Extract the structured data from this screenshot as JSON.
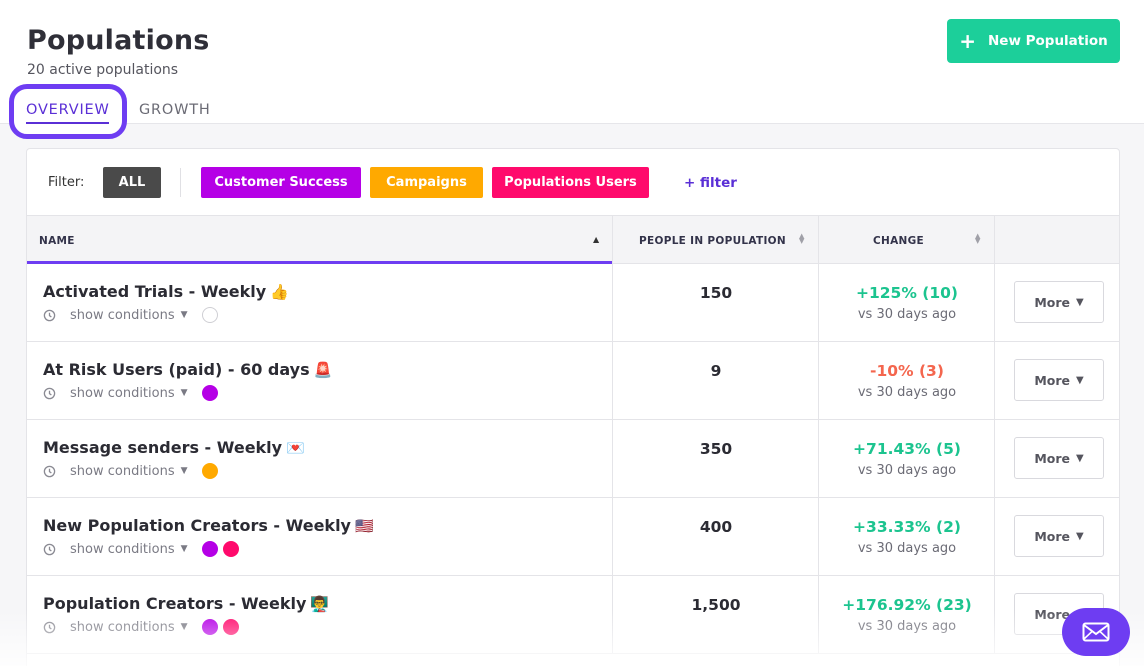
{
  "header": {
    "title": "Populations",
    "subtitle": "20 active populations",
    "new_button_label": "New Population",
    "new_button_icon": "plus-icon"
  },
  "tabs": [
    {
      "label": "OVERVIEW",
      "active": true
    },
    {
      "label": "GROWTH",
      "active": false
    }
  ],
  "filters": {
    "label": "Filter:",
    "chips": [
      {
        "label": "ALL",
        "color": "#4a4a4a"
      },
      {
        "label": "Customer Success",
        "color": "#b500e6"
      },
      {
        "label": "Campaigns",
        "color": "#ffa900"
      },
      {
        "label": "Populations Users",
        "color": "#ff0a6c"
      }
    ],
    "add_filter_label": "+ filter"
  },
  "table": {
    "columns": [
      "NAME",
      "PEOPLE IN POPULATION",
      "CHANGE"
    ],
    "sort": {
      "column": "NAME",
      "direction": "ascending"
    },
    "rows": [
      {
        "name": "Activated Trials - Weekly",
        "emoji": "👍",
        "conditions": "show conditions",
        "tags": [],
        "count": "150",
        "change": "+125% (10)",
        "trend": "positive",
        "vs": "vs 30 days ago",
        "action": "More"
      },
      {
        "name": "At Risk Users (paid) - 60 days",
        "emoji": "🚨",
        "conditions": "show conditions",
        "tags": [
          "#b500e6"
        ],
        "count": "9",
        "change": "-10% (3)",
        "trend": "negative",
        "vs": "vs 30 days ago",
        "action": "More"
      },
      {
        "name": "Message senders - Weekly",
        "emoji": "💌",
        "conditions": "show conditions",
        "tags": [
          "#ffa900"
        ],
        "count": "350",
        "change": "+71.43% (5)",
        "trend": "positive",
        "vs": "vs 30 days ago",
        "action": "More"
      },
      {
        "name": "New Population Creators - Weekly",
        "emoji": "🇺🇸",
        "conditions": "show conditions",
        "tags": [
          "#b500e6",
          "#ff0a6c"
        ],
        "count": "400",
        "change": "+33.33% (2)",
        "trend": "positive",
        "vs": "vs 30 days ago",
        "action": "More"
      },
      {
        "name": "Population Creators - Weekly",
        "emoji": "👨‍🏫",
        "conditions": "show conditions",
        "tags": [
          "#b500e6",
          "#ff0a6c"
        ],
        "count": "1,500",
        "change": "+176.92% (23)",
        "trend": "positive",
        "vs": "vs 30 days ago",
        "action": "More"
      }
    ]
  },
  "chat": {
    "icon": "mail-icon",
    "color": "#6e3df2"
  }
}
